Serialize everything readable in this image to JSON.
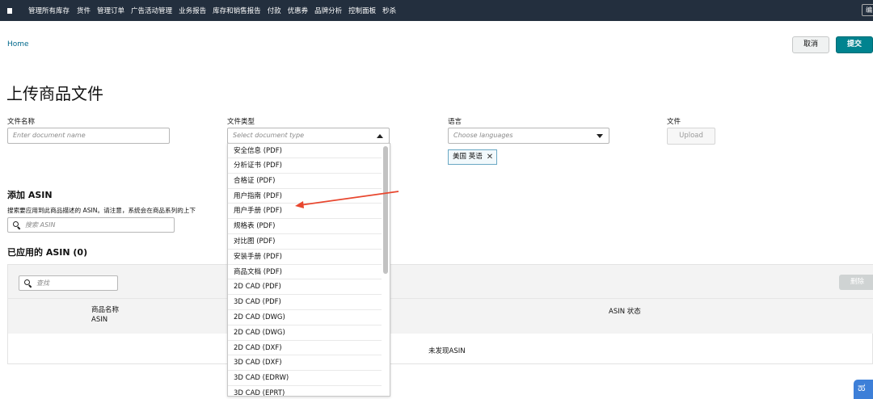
{
  "nav": {
    "items": [
      "管理所有库存",
      "货件",
      "管理订单",
      "广告活动管理",
      "业务报告",
      "库存和销售报告",
      "付款",
      "优惠券",
      "品牌分析",
      "控制面板",
      "秒杀"
    ],
    "right_button": "编"
  },
  "breadcrumb": "Home",
  "actions": {
    "cancel": "取消",
    "submit": "提交"
  },
  "page_title": "上传商品文件",
  "fields": {
    "doc_name": {
      "label": "文件名称",
      "placeholder": "Enter document name"
    },
    "doc_type": {
      "label": "文件类型",
      "placeholder": "Select document type"
    },
    "language": {
      "label": "语言",
      "placeholder": "Choose languages",
      "selected_tag": "美国 英语"
    },
    "file": {
      "label": "文件",
      "upload": "Upload"
    }
  },
  "dropdown_options": [
    "安全信息 (PDF)",
    "分析证书 (PDF)",
    "合格证 (PDF)",
    "用户指南 (PDF)",
    "用户手册 (PDF)",
    "规格表 (PDF)",
    "对比图 (PDF)",
    "安装手册 (PDF)",
    "商品文档 (PDF)",
    "2D CAD (PDF)",
    "3D CAD (PDF)",
    "2D CAD (DWG)",
    "2D CAD (DWG)",
    "2D CAD (DXF)",
    "3D CAD (DXF)",
    "3D CAD (EDRW)",
    "3D CAD (EPRT)"
  ],
  "add_asin": {
    "title": "添加 ASIN",
    "hint": "搜索要应用到此商品描述的 ASIN。请注意，系统会在商品系列的上下",
    "search_placeholder": "搜索 ASIN"
  },
  "applied_asin": {
    "title": "已应用的 ASIN (0)",
    "find_placeholder": "查找",
    "delete": "删除",
    "col_name_1": "商品名称",
    "col_name_2": "ASIN",
    "col_status": "ASIN 状态",
    "empty": "未发现ASIN"
  },
  "colors": {
    "nav_bg": "#232f3e",
    "primary": "#00838f",
    "arrow": "#e8472f"
  }
}
